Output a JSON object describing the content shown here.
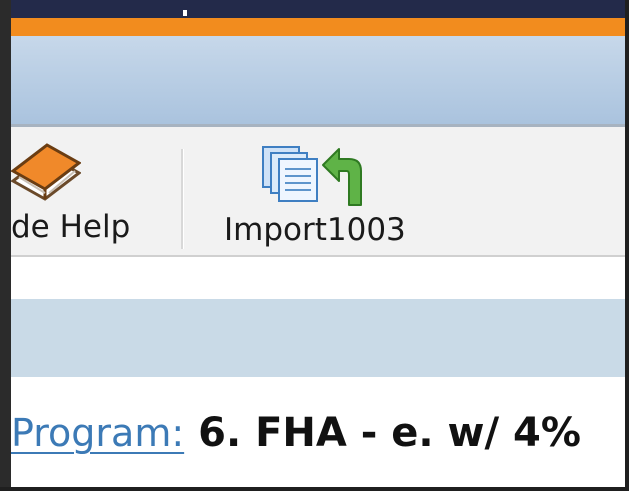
{
  "toolbar": {
    "help_label": "de Help",
    "help_icon": "book-icon",
    "import_label": "Import1003",
    "import_icon": "import-documents-icon"
  },
  "form": {
    "program_label": "Program:",
    "program_value": "6. FHA - e. w/ 4%"
  },
  "colors": {
    "accent_orange": "#f28c1e",
    "header_blue": "#aac3de",
    "band_blue": "#c9dae7",
    "link_blue": "#3c7ab6"
  }
}
